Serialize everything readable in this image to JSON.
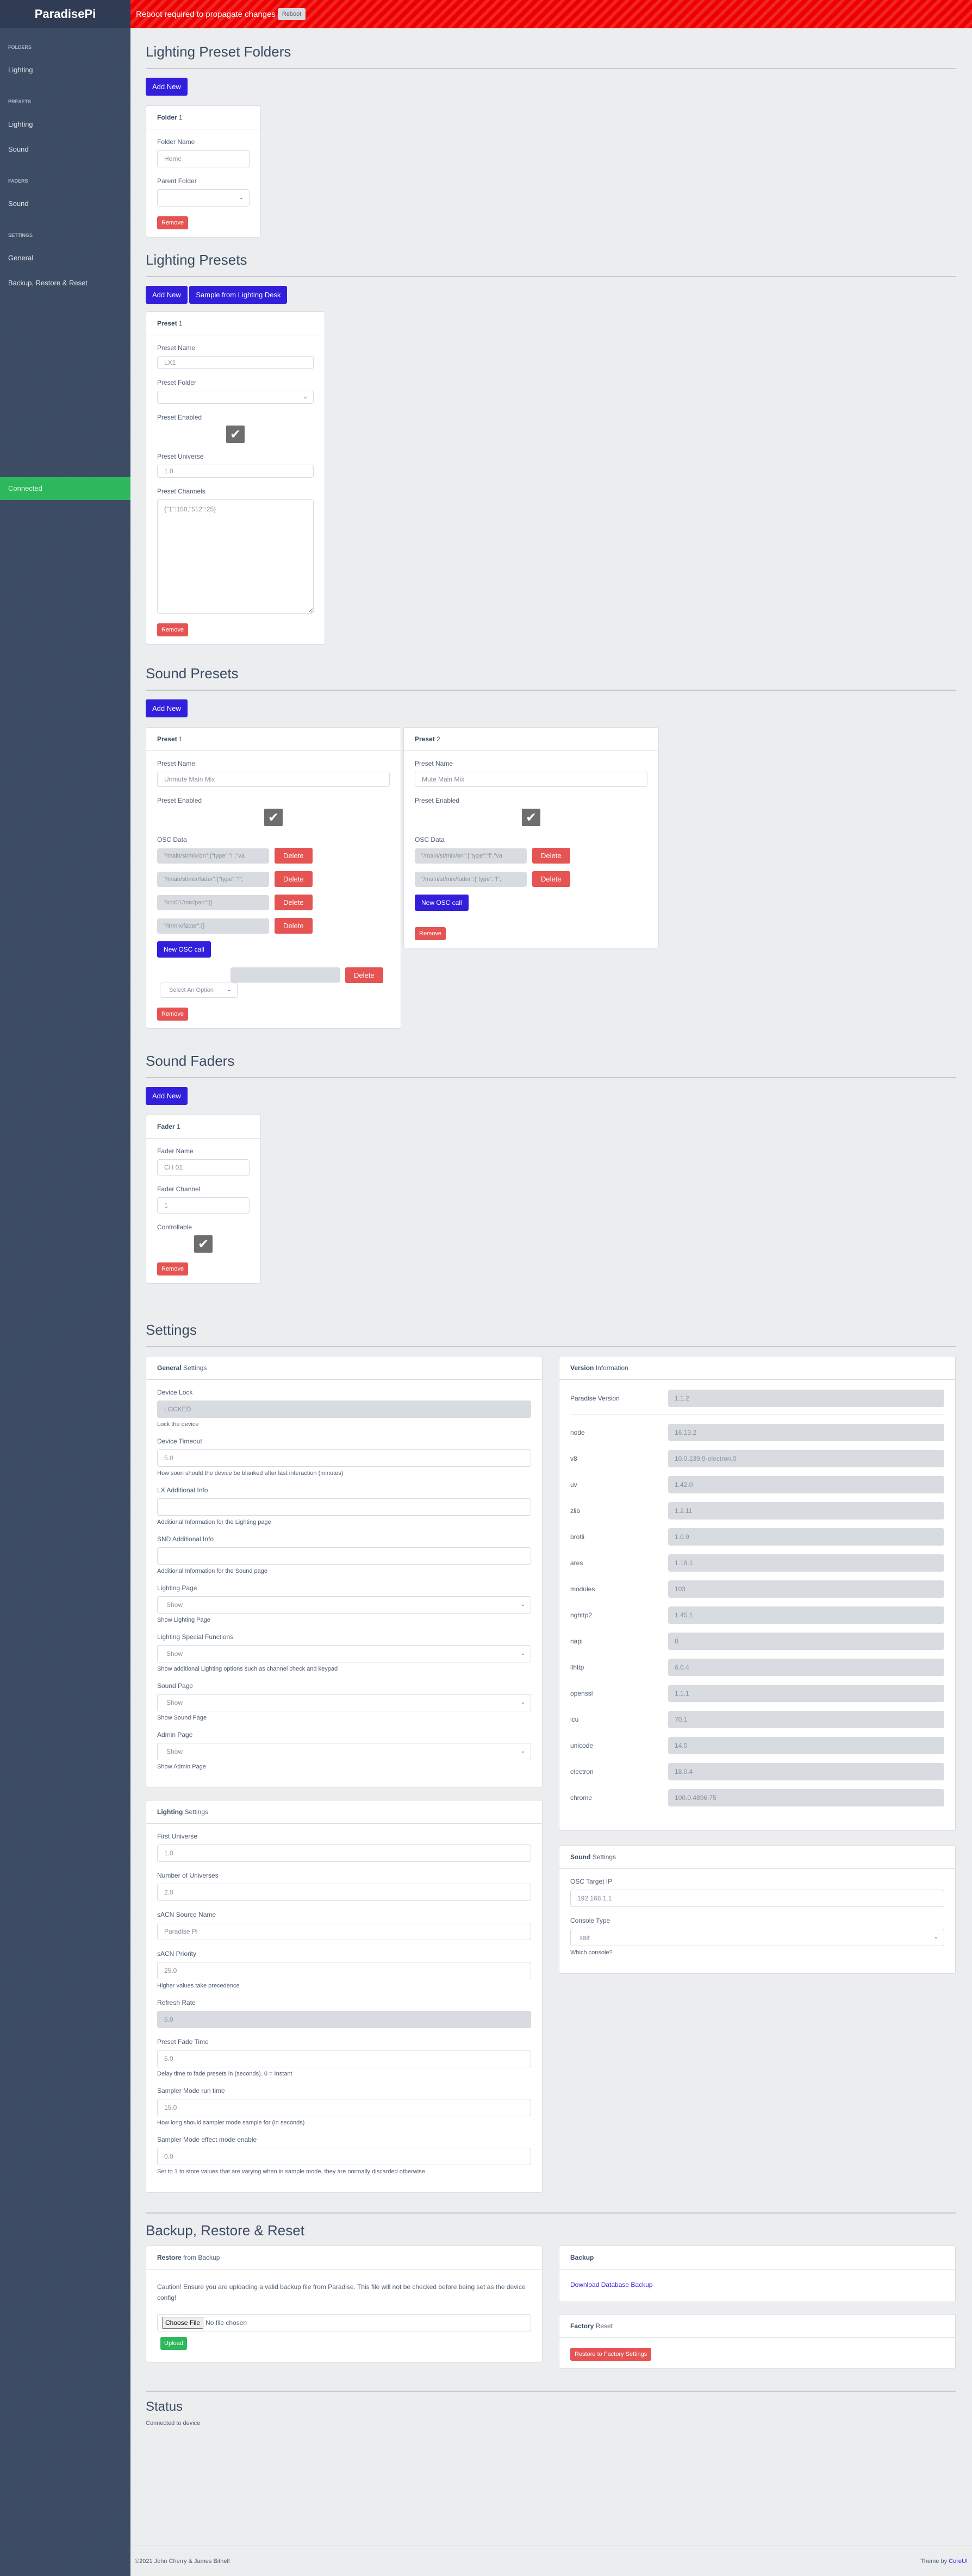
{
  "app": {
    "brand": "ParadisePi"
  },
  "topbar": {
    "message": "Reboot required to propagate changes",
    "reboot_label": "Reboot"
  },
  "sidebar": {
    "sections": [
      {
        "title": "FOLDERS",
        "items": [
          "Lighting"
        ]
      },
      {
        "title": "PRESETS",
        "items": [
          "Lighting",
          "Sound"
        ]
      },
      {
        "title": "FADERS",
        "items": [
          "Sound"
        ]
      },
      {
        "title": "SETTINGS",
        "items": [
          "General",
          "Backup, Restore & Reset"
        ]
      }
    ],
    "connection_status": "Connected",
    "status_color": "#2eb85c"
  },
  "colors": {
    "primary": "#321fdb",
    "danger": "#e55353",
    "success": "#2eb85c",
    "sidebar": "#3c4b64",
    "banner": "#ee0000"
  },
  "lighting_folders": {
    "title": "Lighting Preset Folders",
    "add_label": "Add New",
    "folder": {
      "header_bold": "Folder",
      "header_num": "1",
      "name_label": "Folder Name",
      "name_value": "Home",
      "parent_label": "Parent Folder",
      "parent_value": "",
      "remove_label": "Remove"
    }
  },
  "lighting_presets": {
    "title": "Lighting Presets",
    "add_label": "Add New",
    "sample_label": "Sample from Lighting Desk",
    "preset": {
      "header_bold": "Preset",
      "header_num": "1",
      "name_label": "Preset Name",
      "name_value": "LX1",
      "folder_label": "Preset Folder",
      "folder_value": "",
      "enabled_label": "Preset Enabled",
      "enabled": true,
      "universe_label": "Preset Universe",
      "universe_value": "1.0",
      "channels_label": "Preset Channels",
      "channels_value": "{\"1\":150,\"512\":25}",
      "remove_label": "Remove"
    }
  },
  "sound_presets": {
    "title": "Sound Presets",
    "add_label": "Add New",
    "presets": [
      {
        "header_bold": "Preset",
        "header_num": "1",
        "name_label": "Preset Name",
        "name_value": "Unmute Main Mix",
        "enabled_label": "Preset Enabled",
        "enabled": true,
        "osc_label": "OSC Data",
        "osc": [
          "\"/main/st/mix/on\":{\"type\":\"i\",\"va",
          "\"/main/st/mix/fader\":{\"type\":\"f\",",
          "\"/ch/01/mix/pan\":{}",
          "\"/lr/mix/fader\":{}"
        ],
        "delete_label": "Delete",
        "new_osc_label": "New OSC call",
        "new_row_value": "",
        "select_placeholder": "Select An Option",
        "remove_label": "Remove"
      },
      {
        "header_bold": "Preset",
        "header_num": "2",
        "name_label": "Preset Name",
        "name_value": "Mute Main Mix",
        "enabled_label": "Preset Enabled",
        "enabled": true,
        "osc_label": "OSC Data",
        "osc": [
          "\"/main/st/mix/on\":{\"type\":\"i\",\"va",
          "\"/main/st/mix/fader\":{\"type\":\"f\","
        ],
        "delete_label": "Delete",
        "new_osc_label": "New OSC call",
        "remove_label": "Remove"
      }
    ]
  },
  "sound_faders": {
    "title": "Sound Faders",
    "add_label": "Add New",
    "fader": {
      "header_bold": "Fader",
      "header_num": "1",
      "name_label": "Fader Name",
      "name_value": "CH 01",
      "channel_label": "Fader Channel",
      "channel_value": "1",
      "controllable_label": "Controllable",
      "controllable": true,
      "remove_label": "Remove"
    }
  },
  "settings": {
    "title": "Settings",
    "general": {
      "header_bold": "General",
      "header_sub": "Settings",
      "fields": [
        {
          "label": "Device Lock",
          "value": "LOCKED",
          "type": "readonly",
          "help": "Lock the device"
        },
        {
          "label": "Device Timeout",
          "value": "5.0",
          "type": "input",
          "help": "How soon should the device be blanked after last interaction (minutes)"
        },
        {
          "label": "LX Additional Info",
          "value": "",
          "type": "input",
          "help": "Additional Information for the Lighting page"
        },
        {
          "label": "SND Additional Info",
          "value": "",
          "type": "input",
          "help": "Additional Information for the Sound page"
        },
        {
          "label": "Lighting Page",
          "value": "Show",
          "type": "select",
          "help": "Show Lighting Page"
        },
        {
          "label": "Lighting Special Functions",
          "value": "Show",
          "type": "select",
          "help": "Show additional Lighting options such as channel check and keypad"
        },
        {
          "label": "Sound Page",
          "value": "Show",
          "type": "select",
          "help": "Show Sound Page"
        },
        {
          "label": "Admin Page",
          "value": "Show",
          "type": "select",
          "help": "Show Admin Page"
        }
      ]
    },
    "version": {
      "header_bold": "Version",
      "header_sub": "Information",
      "paradise": {
        "label": "Paradise Version",
        "value": "1.1.2"
      },
      "rows": [
        {
          "label": "node",
          "value": "16.13.2"
        },
        {
          "label": "v8",
          "value": "10.0.139.9-electron.0"
        },
        {
          "label": "uv",
          "value": "1.42.0"
        },
        {
          "label": "zlib",
          "value": "1.2.11"
        },
        {
          "label": "brotli",
          "value": "1.0.9"
        },
        {
          "label": "ares",
          "value": "1.18.1"
        },
        {
          "label": "modules",
          "value": "103"
        },
        {
          "label": "nghttp2",
          "value": "1.45.1"
        },
        {
          "label": "napi",
          "value": "8"
        },
        {
          "label": "llhttp",
          "value": "6.0.4"
        },
        {
          "label": "openssl",
          "value": "1.1.1"
        },
        {
          "label": "icu",
          "value": "70.1"
        },
        {
          "label": "unicode",
          "value": "14.0"
        },
        {
          "label": "electron",
          "value": "18.0.4"
        },
        {
          "label": "chrome",
          "value": "100.0.4896.75"
        }
      ]
    },
    "lighting": {
      "header_bold": "Lighting",
      "header_sub": "Settings",
      "fields": [
        {
          "label": "First Universe",
          "value": "1.0",
          "type": "input",
          "help": ""
        },
        {
          "label": "Number of Universes",
          "value": "2.0",
          "type": "input",
          "help": ""
        },
        {
          "label": "sACN Source Name",
          "value": "Paradise Pi",
          "type": "input",
          "help": ""
        },
        {
          "label": "sACN Priority",
          "value": "25.0",
          "type": "input",
          "help": "Higher values take precedence"
        },
        {
          "label": "Refresh Rate",
          "value": "5.0",
          "type": "readonly",
          "help": ""
        },
        {
          "label": "Preset Fade Time",
          "value": "5.0",
          "type": "input",
          "help": "Delay time to fade presets in (seconds). 0 = Instant"
        },
        {
          "label": "Sampler Mode run time",
          "value": "15.0",
          "type": "input",
          "help": "How long should sampler mode sample for (in seconds)"
        },
        {
          "label": "Sampler Mode effect mode enable",
          "value": "0.0",
          "type": "input",
          "help": "Set to 1 to store values that are varying when in sample mode, they are normally discarded otherwise"
        }
      ]
    },
    "sound": {
      "header_bold": "Sound",
      "header_sub": "Settings",
      "fields": [
        {
          "label": "OSC Target IP",
          "value": "192.168.1.1",
          "type": "input",
          "help": ""
        },
        {
          "label": "Console Type",
          "value": "xair",
          "type": "select",
          "help": "Which console?"
        }
      ]
    }
  },
  "backup": {
    "title": "Backup, Restore & Reset",
    "restore": {
      "header_bold": "Restore",
      "header_sub": "from Backup",
      "caution": "Caution! Ensure you are uploading a valid backup file from Paradise. This file will not be checked before being set as the device config!",
      "choose_label": "Choose File",
      "no_file": "No file chosen",
      "upload_label": "Upload"
    },
    "backup_card": {
      "header_bold": "Backup",
      "link": "Download Database Backup"
    },
    "factory": {
      "header_bold": "Factory",
      "header_sub": "Reset",
      "button": "Restore to Factory Settings"
    }
  },
  "status": {
    "title": "Status",
    "text": "Connected to device"
  },
  "footer": {
    "copyright": "©2021 John Cherry & James Bithell",
    "theme_prefix": "Theme by",
    "theme_link": "CoreUI"
  }
}
